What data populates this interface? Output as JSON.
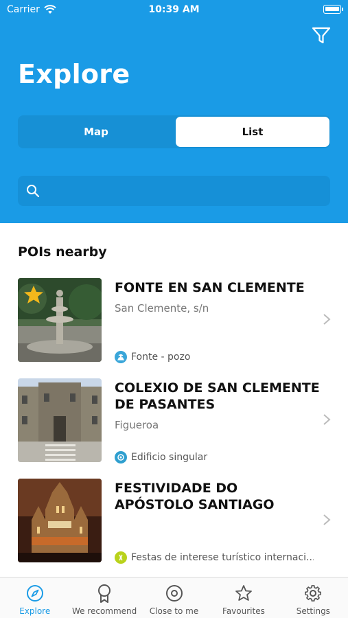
{
  "status_bar": {
    "carrier": "Carrier",
    "time": "10:39 AM",
    "battery_level": 0.95
  },
  "header": {
    "title": "Explore",
    "segments": [
      {
        "label": "Map",
        "selected": false
      },
      {
        "label": "List",
        "selected": true
      }
    ],
    "search": {
      "placeholder": "",
      "value": ""
    }
  },
  "section": {
    "title": "POIs nearby"
  },
  "pois": [
    {
      "name": "FONTE EN SAN CLEMENTE",
      "address": "San Clemente, s/n",
      "category": "Fonte - pozo",
      "category_color": "#3aa6d9",
      "favourite": true
    },
    {
      "name": "COLEXIO DE SAN CLEMENTE DE PASANTES",
      "address": "Figueroa",
      "category": "Edificio singular",
      "category_color": "#2f9fcf",
      "favourite": false
    },
    {
      "name": "FESTIVIDADE DO APÓSTOLO SANTIAGO",
      "address": "",
      "category": "Festas de interese turístico internaci...",
      "category_color": "#b9d21b",
      "favourite": false
    }
  ],
  "tabbar": {
    "items": [
      {
        "label": "Explore",
        "icon": "compass-icon",
        "active": true
      },
      {
        "label": "We recommend",
        "icon": "award-icon",
        "active": false
      },
      {
        "label": "Close to me",
        "icon": "target-icon",
        "active": false
      },
      {
        "label": "Favourites",
        "icon": "star-icon",
        "active": false
      },
      {
        "label": "Settings",
        "icon": "gear-icon",
        "active": false
      }
    ]
  },
  "colors": {
    "brand": "#1a9be6",
    "favourite_star": "#f3b81b"
  }
}
